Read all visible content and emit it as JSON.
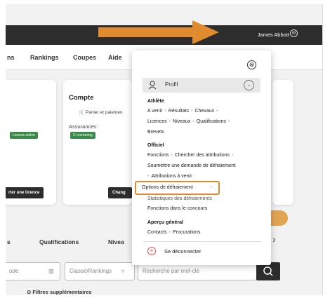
{
  "topbar": {
    "user_name": "James Abbott",
    "user_chevron": "⊝"
  },
  "nav": [
    "ns",
    "Rankings",
    "Coupes",
    "Aide"
  ],
  "account": {
    "title": "Compte",
    "cart_label": "Panier et paiemen",
    "insurance_label": "Assurances:",
    "license_badge": "Licence active",
    "insurance_badge": "C-recréaring",
    "license_button": "rter une licence",
    "change_button": "Chang"
  },
  "tabs": [
    "s",
    "Qualifications",
    "Nivea"
  ],
  "search": {
    "left_field": "ode",
    "ranking_select": "Classé/Rankings",
    "keyword_placeholder": "Recherche par mot-clé"
  },
  "filters_label": "Filtres supplémentaires",
  "menu": {
    "close_glyph": "⊗",
    "profile_label": "Profil",
    "athlete": {
      "heading": "Athlète",
      "rows": [
        [
          "A venir",
          "Résultats",
          "Chevaux"
        ],
        [
          "Licences",
          "Niveaux",
          "Qualifications"
        ],
        [
          "Brevets"
        ]
      ]
    },
    "official": {
      "heading": "Officiel",
      "row1": [
        "Fonctions",
        "Chercher des attributions"
      ],
      "row2": "Soumettre une demande de défraiement",
      "row3": "Attributions à venir",
      "highlighted": "Options de défraiement",
      "row5": "Statistiques des défraiements",
      "row6": "Fonctions dans le concours"
    },
    "overview": {
      "heading": "Aperçu général",
      "row": [
        "Contacts",
        "Procurations"
      ]
    },
    "logout_label": "Se déconnecter"
  },
  "colors": {
    "accent_orange": "#e08b2e",
    "dark_bar": "#2d2d2d",
    "logout_red": "#d9534f"
  }
}
